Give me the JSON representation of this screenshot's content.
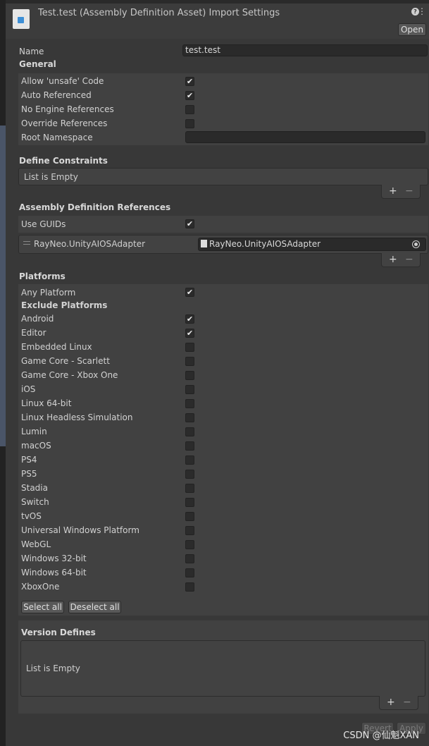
{
  "header": {
    "title": "Test.test (Assembly Definition Asset) Import Settings",
    "open_label": "Open",
    "help_glyph": "?",
    "more_glyph": "⋮"
  },
  "name_field": {
    "label": "Name",
    "value": "test.test"
  },
  "general": {
    "title": "General",
    "items": [
      {
        "label": "Allow 'unsafe' Code",
        "checked": true
      },
      {
        "label": "Auto Referenced",
        "checked": true
      },
      {
        "label": "No Engine References",
        "checked": false
      },
      {
        "label": "Override References",
        "checked": false
      }
    ],
    "root_namespace": {
      "label": "Root Namespace",
      "value": ""
    }
  },
  "define_constraints": {
    "title": "Define Constraints",
    "empty_label": "List is Empty"
  },
  "assembly_refs": {
    "title": "Assembly Definition References",
    "use_guids_label": "Use GUIDs",
    "use_guids_checked": true,
    "reference_name": "RayNeo.UnityAIOSAdapter",
    "reference_value": "RayNeo.UnityAIOSAdapter"
  },
  "platforms": {
    "title": "Platforms",
    "any_platform_label": "Any Platform",
    "any_platform_checked": true,
    "exclude_title": "Exclude Platforms",
    "items": [
      {
        "label": "Android",
        "checked": true
      },
      {
        "label": "Editor",
        "checked": true
      },
      {
        "label": "Embedded Linux",
        "checked": false
      },
      {
        "label": "Game Core - Scarlett",
        "checked": false
      },
      {
        "label": "Game Core - Xbox One",
        "checked": false
      },
      {
        "label": "iOS",
        "checked": false
      },
      {
        "label": "Linux 64-bit",
        "checked": false
      },
      {
        "label": "Linux Headless Simulation",
        "checked": false
      },
      {
        "label": "Lumin",
        "checked": false
      },
      {
        "label": "macOS",
        "checked": false
      },
      {
        "label": "PS4",
        "checked": false
      },
      {
        "label": "PS5",
        "checked": false
      },
      {
        "label": "Stadia",
        "checked": false
      },
      {
        "label": "Switch",
        "checked": false
      },
      {
        "label": "tvOS",
        "checked": false
      },
      {
        "label": "Universal Windows Platform",
        "checked": false
      },
      {
        "label": "WebGL",
        "checked": false
      },
      {
        "label": "Windows 32-bit",
        "checked": false
      },
      {
        "label": "Windows 64-bit",
        "checked": false
      },
      {
        "label": "XboxOne",
        "checked": false
      }
    ],
    "select_all_label": "Select all",
    "deselect_all_label": "Deselect all"
  },
  "version_defines": {
    "title": "Version Defines",
    "empty_label": "List is Empty"
  },
  "list_controls": {
    "plus": "+",
    "minus": "−"
  },
  "check_glyph": "✔",
  "footer": {
    "revert_label": "Revert",
    "apply_label": "Apply",
    "watermark": "CSDN @仙魁XAN"
  },
  "colors": {
    "background": "#383838",
    "panel": "#414141",
    "field": "#2a2a2a",
    "accent_icon": "#3d8fd6"
  }
}
